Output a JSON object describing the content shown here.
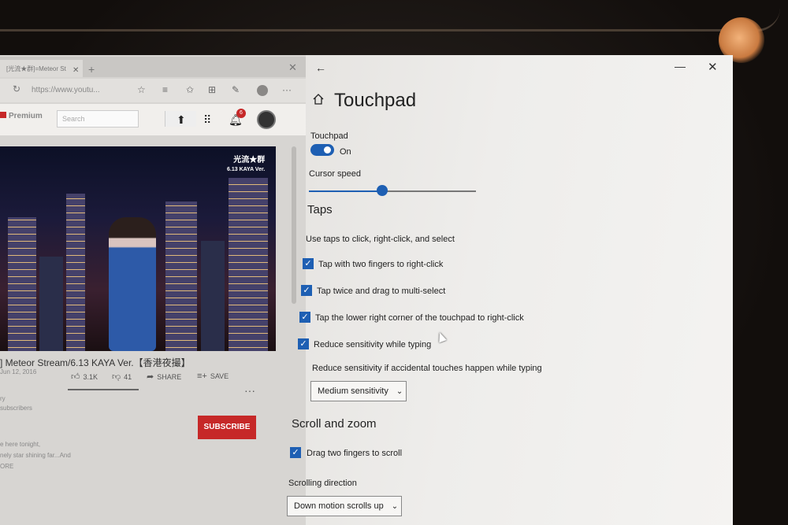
{
  "browser": {
    "tab_title": "[光流★群]=Meteor St",
    "url": "https://www.youtu...",
    "youtube": {
      "logo": "Premium",
      "search_placeholder": "Search",
      "notif_count": "6",
      "video_overlay_line1": "光流★群",
      "video_overlay_line2": "6.13 KAYA Ver.",
      "video_title": "] Meteor Stream/6.13 KAYA Ver.【香港夜撮】",
      "video_date": "Jun 12, 2016",
      "likes": "3.1K",
      "dislikes": "41",
      "share_label": "SHARE",
      "save_label": "SAVE",
      "subscribe_label": "SUBSCRIBE",
      "desc_line1": "ry",
      "desc_line2": "subscribers",
      "desc_line3": "e here tonight,",
      "desc_line4": "nely star shining far...And",
      "desc_line5": "ORE"
    }
  },
  "settings": {
    "page_title": "Touchpad",
    "touchpad_label": "Touchpad",
    "touchpad_state": "On",
    "cursor_speed_label": "Cursor speed",
    "cursor_speed_value": 0.44,
    "taps_heading": "Taps",
    "taps_desc": "Use taps to click, right-click, and select",
    "checkboxes": [
      {
        "label": "Tap with two fingers to right-click",
        "checked": true
      },
      {
        "label": "Tap twice and drag to multi-select",
        "checked": true
      },
      {
        "label": "Tap the lower right corner of the touchpad to right-click",
        "checked": true
      },
      {
        "label": "Reduce sensitivity while typing",
        "checked": true
      }
    ],
    "sensitivity_desc": "Reduce sensitivity if accidental touches happen while typing",
    "sensitivity_value": "Medium sensitivity",
    "scroll_heading": "Scroll and zoom",
    "scroll_checkbox": {
      "label": "Drag two fingers to scroll",
      "checked": true
    },
    "scroll_direction_label": "Scrolling direction",
    "scroll_direction_value": "Down motion scrolls up"
  },
  "colors": {
    "accent": "#1e5fb3",
    "youtube_red": "#c62828"
  }
}
